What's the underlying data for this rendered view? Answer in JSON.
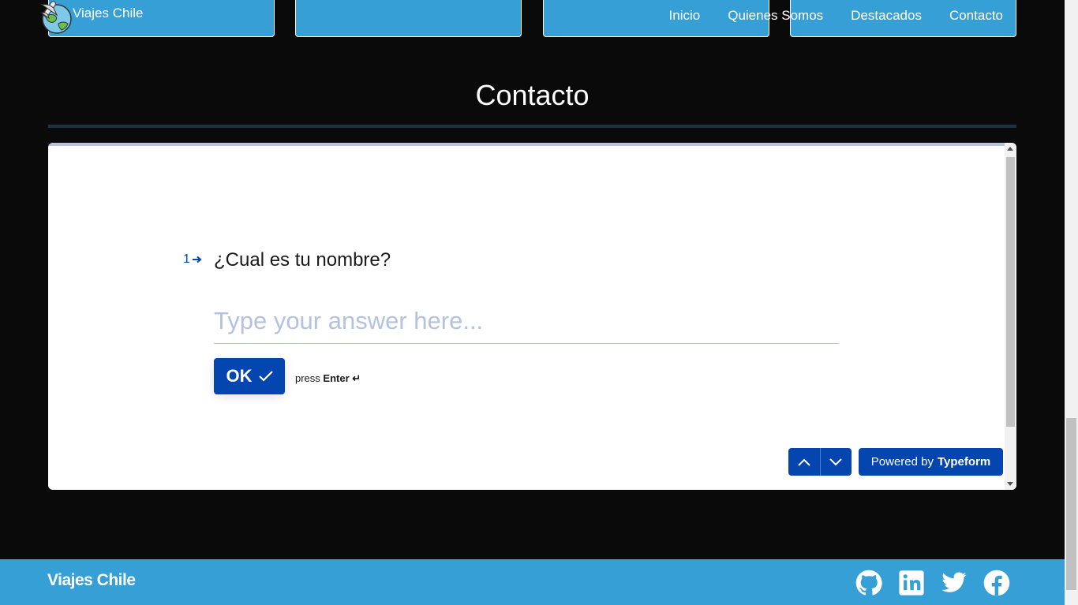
{
  "navbar": {
    "brand": "Viajes Chile",
    "links": [
      "Inicio",
      "Quienes Somos",
      "Destacados",
      "Contacto"
    ]
  },
  "section": {
    "title": "Contacto"
  },
  "form": {
    "question_number": "1",
    "question": "¿Cual es tu nombre?",
    "answer_placeholder": "Type your answer here...",
    "ok_label": "OK",
    "press_prefix": "press",
    "press_key": "Enter ↵",
    "powered_prefix": "Powered by",
    "powered_brand": "Typeform",
    "accent_color": "#0445af"
  },
  "footer": {
    "brand": "Viajes Chile",
    "social_icons": [
      "github-icon",
      "linkedin-icon",
      "twitter-icon",
      "facebook-icon"
    ],
    "background_color": "#359fd6"
  }
}
